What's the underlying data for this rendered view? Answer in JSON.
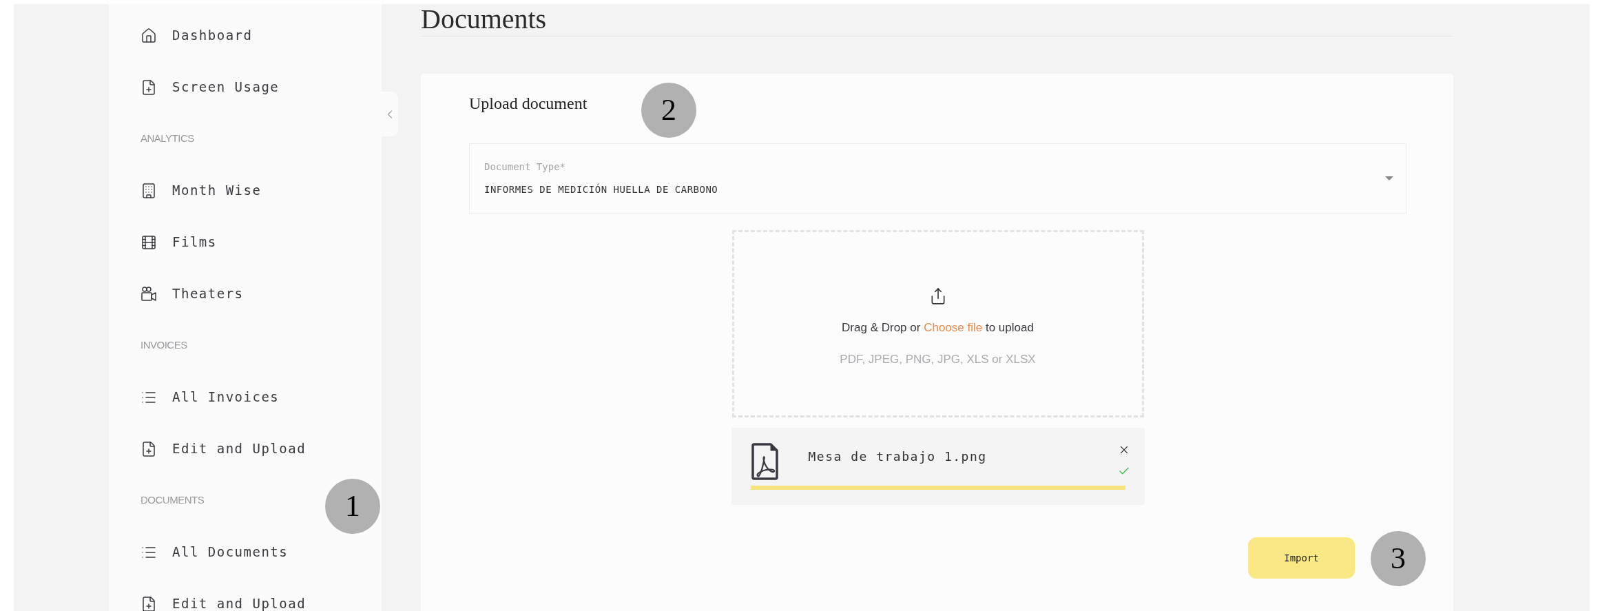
{
  "sidebar": {
    "items": [
      {
        "kind": "link",
        "label": "Dashboard"
      },
      {
        "kind": "link",
        "label": "Screen Usage"
      },
      {
        "kind": "heading",
        "label": "ANALYTICS"
      },
      {
        "kind": "link",
        "label": "Month Wise"
      },
      {
        "kind": "link",
        "label": "Films"
      },
      {
        "kind": "link",
        "label": "Theaters"
      },
      {
        "kind": "heading",
        "label": "INVOICES"
      },
      {
        "kind": "link",
        "label": "All Invoices"
      },
      {
        "kind": "link",
        "label": "Edit and Upload"
      },
      {
        "kind": "heading",
        "label": "DOCUMENTS"
      },
      {
        "kind": "link",
        "label": "All Documents"
      },
      {
        "kind": "link",
        "label": "Edit and Upload"
      }
    ]
  },
  "page": {
    "title": "Documents"
  },
  "upload_card": {
    "title": "Upload document",
    "document_type": {
      "label": "Document Type*",
      "value": "INFORMES DE MEDICIÓN HUELLA DE CARBONO"
    },
    "dropzone": {
      "prompt_before": "Drag & Drop or",
      "link": "Choose file",
      "prompt_after": "to upload",
      "formats": "PDF, JPEG, PNG, JPG, XLS or XLSX"
    },
    "file": {
      "name": "Mesa de trabajo 1.png",
      "done": true
    },
    "import_button": "Import"
  },
  "markers": [
    {
      "label": "1"
    },
    {
      "label": "2"
    },
    {
      "label": "3"
    }
  ]
}
